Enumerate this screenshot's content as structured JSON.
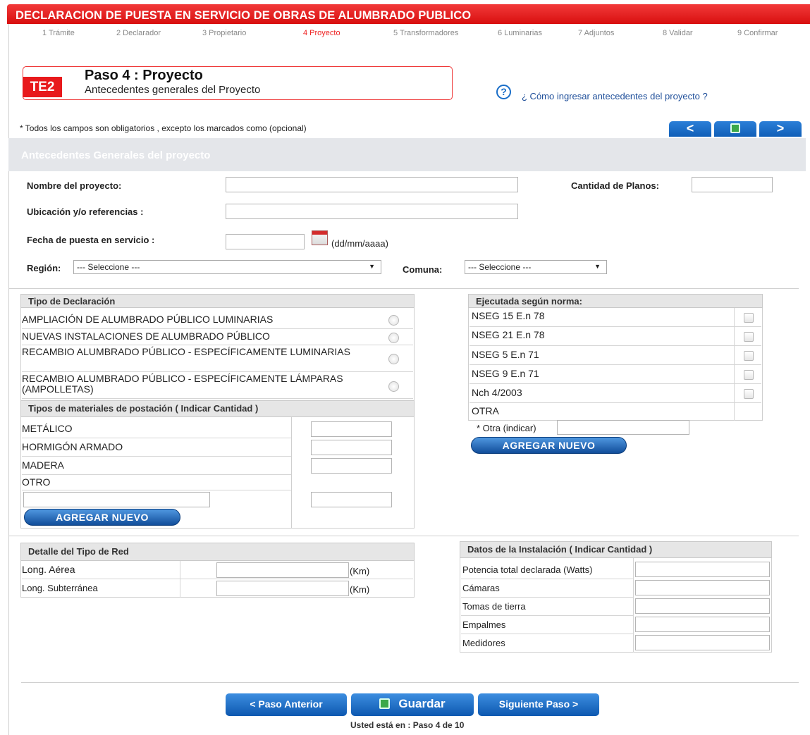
{
  "header": {
    "title": "DECLARACION DE PUESTA EN SERVICIO DE OBRAS DE ALUMBRADO PUBLICO",
    "steps": [
      "1 Trámite",
      "2 Declarador",
      "3 Propietario",
      "4 Proyecto",
      "5 Transformadores",
      "6 Luminarias",
      "7 Adjuntos",
      "8 Validar",
      "9 Confirmar"
    ]
  },
  "step_box": {
    "badge": "TE2",
    "title": "Paso 4 : Proyecto",
    "subtitle": "Antecedentes generales del Proyecto"
  },
  "help": {
    "icon": "?",
    "link": "¿ Cómo ingresar antecedentes del proyecto ?"
  },
  "note": "* Todos los campos son obligatorios , excepto los marcados como (opcional)",
  "nav": {
    "prev": "<",
    "next": ">"
  },
  "section_title": "Antecedentes Generales del proyecto",
  "form": {
    "nombre_label": "Nombre del proyecto:",
    "planos_label": "Cantidad de Planos:",
    "ubicacion_label": "Ubicación y/o referencias :",
    "fecha_label": "Fecha de puesta en servicio :",
    "fecha_hint": "(dd/mm/aaaa)",
    "region_label": "Región:",
    "region_value": "--- Seleccione ---",
    "comuna_label": "Comuna:",
    "comuna_value": "--- Seleccione ---"
  },
  "tipo_declaracion": {
    "header": "Tipo de Declaración",
    "options": [
      "AMPLIACIÓN DE ALUMBRADO PÚBLICO LUMINARIAS",
      "NUEVAS INSTALACIONES DE ALUMBRADO PÚBLICO",
      "RECAMBIO ALUMBRADO PÚBLICO - ESPECÍFICAMENTE LUMINARIAS",
      "RECAMBIO ALUMBRADO PÚBLICO - ESPECÍFICAMENTE LÁMPARAS (AMPOLLETAS)"
    ]
  },
  "materiales": {
    "header": "Tipos de materiales de postación ( Indicar Cantidad )",
    "rows": [
      "METÁLICO",
      "HORMIGÓN ARMADO",
      "MADERA",
      "OTRO"
    ],
    "add_button": "AGREGAR NUEVO"
  },
  "norma": {
    "header": "Ejecutada según norma:",
    "rows": [
      "NSEG 15 E.n 78",
      "NSEG 21 E.n 78",
      "NSEG 5 E.n 71",
      "NSEG 9 E.n 71",
      "Nch 4/2003",
      "OTRA"
    ],
    "otra_label": "* Otra (indicar)",
    "add_button": "AGREGAR NUEVO"
  },
  "red": {
    "header": "Detalle del Tipo de Red",
    "rows": [
      {
        "label": "Long. Aérea",
        "unit": "(Km)"
      },
      {
        "label": "Long. Subterránea",
        "unit": "(Km)"
      }
    ]
  },
  "instalacion": {
    "header": "Datos de la Instalación ( Indicar Cantidad )",
    "rows": [
      "Potencia total declarada (Watts)",
      "Cámaras",
      "Tomas de tierra",
      "Empalmes",
      "Medidores"
    ]
  },
  "footer": {
    "prev": "< Paso Anterior",
    "save": "Guardar",
    "next": "Siguiente Paso >",
    "status": "Usted está en : Paso 4 de 10"
  },
  "colors": {
    "brand_red": "#e8191c",
    "button_blue": "#1a6ec8"
  }
}
